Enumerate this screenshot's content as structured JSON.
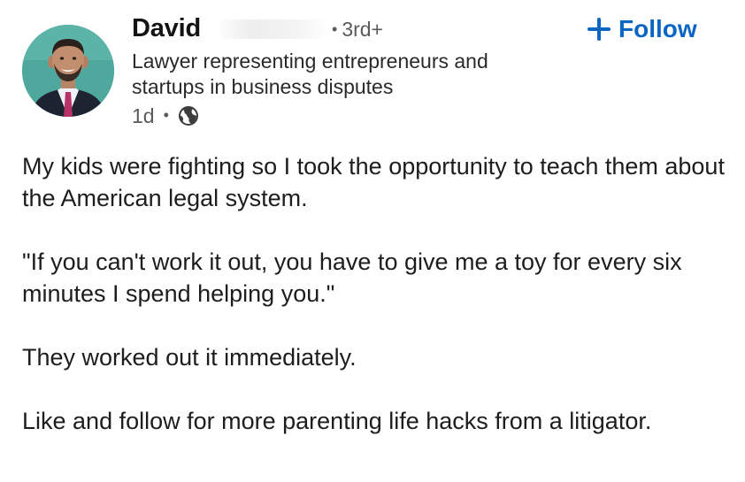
{
  "post": {
    "author": {
      "name": "David",
      "connection_degree": "3rd+",
      "headline": "Lawyer representing entrepreneurs and startups in business disputes",
      "headline_lines": [
        "Lawyer representing entrepreneurs and",
        "startups in business disputes"
      ],
      "time_ago": "1d",
      "separator": "•",
      "visibility_icon": "globe-icon"
    },
    "follow_button": {
      "label": "Follow",
      "icon": "plus-icon",
      "color": "#0a66c2"
    },
    "body": {
      "paragraph_1": "My kids were fighting so I took the opportunity to teach them about the American legal system.",
      "paragraph_2": "\"If you can't work it out, you have to give me a toy for every six minutes I spend helping you.\"",
      "paragraph_3": "They worked out it immediately.",
      "paragraph_4": "Like and follow for more parenting life hacks from a litigator."
    }
  }
}
